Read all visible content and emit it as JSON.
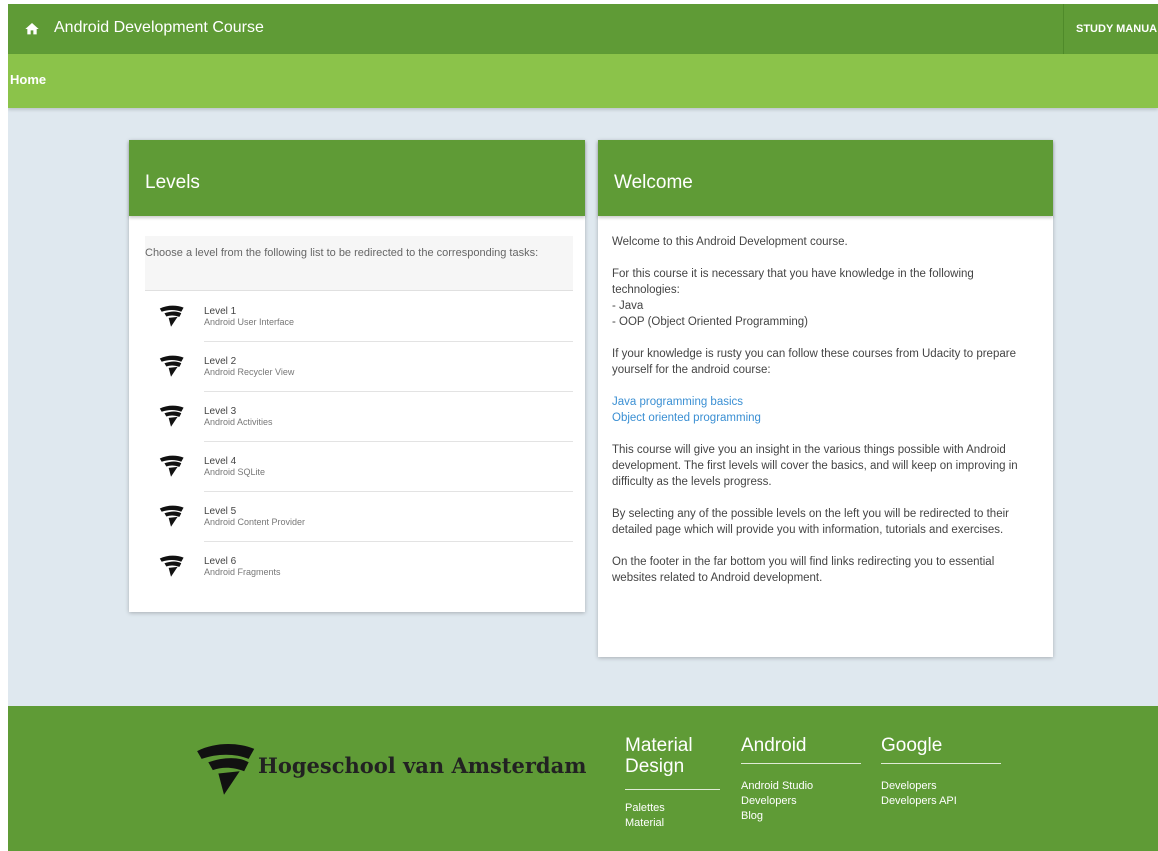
{
  "header": {
    "title": "Android Development Course",
    "study_manual": "STUDY MANUA"
  },
  "subbar": {
    "title": "Home"
  },
  "levels_card": {
    "title": "Levels",
    "intro": "Choose a level from the following list to be redirected to the corresponding tasks:",
    "items": [
      {
        "name": "Level 1",
        "subtitle": "Android User Interface"
      },
      {
        "name": "Level 2",
        "subtitle": "Android Recycler View"
      },
      {
        "name": "Level 3",
        "subtitle": "Android Activities"
      },
      {
        "name": "Level 4",
        "subtitle": "Android SQLite"
      },
      {
        "name": "Level 5",
        "subtitle": "Android Content Provider"
      },
      {
        "name": "Level 6",
        "subtitle": "Android Fragments"
      }
    ]
  },
  "welcome_card": {
    "title": "Welcome",
    "p1": "Welcome to this Android Development course.",
    "p2": "For this course it is necessary that you have knowledge in the following technologies:",
    "tech1": "- Java",
    "tech2": "- OOP (Object Oriented Programming)",
    "p3": "If your knowledge is rusty you can follow these courses from Udacity to prepare yourself for the android course:",
    "link1": "Java programming basics",
    "link2": "Object oriented programming",
    "p4": "This course will give you an insight in the various things possible with Android development. The first levels will cover the basics, and will keep on improving in difficulty as the levels progress.",
    "p5": "By selecting any of the possible levels on the left you will be redirected to their detailed page which will provide you with information, tutorials and exercises.",
    "p6": "On the footer in the far bottom you will find links redirecting you to essential websites related to Android development."
  },
  "footer": {
    "brand": "Hogeschool van Amsterdam",
    "material": {
      "heading": "Material Design",
      "links": [
        "Palettes",
        "Material"
      ]
    },
    "android": {
      "heading": "Android",
      "links": [
        "Android Studio",
        "Developers",
        "Blog"
      ]
    },
    "google": {
      "heading": "Google",
      "links": [
        "Developers",
        "Developers API"
      ]
    }
  },
  "colors": {
    "dark_green": "#5f9b36",
    "light_green": "#8bc34a",
    "background": "#dfe8ef",
    "link": "#3a8fd3"
  }
}
